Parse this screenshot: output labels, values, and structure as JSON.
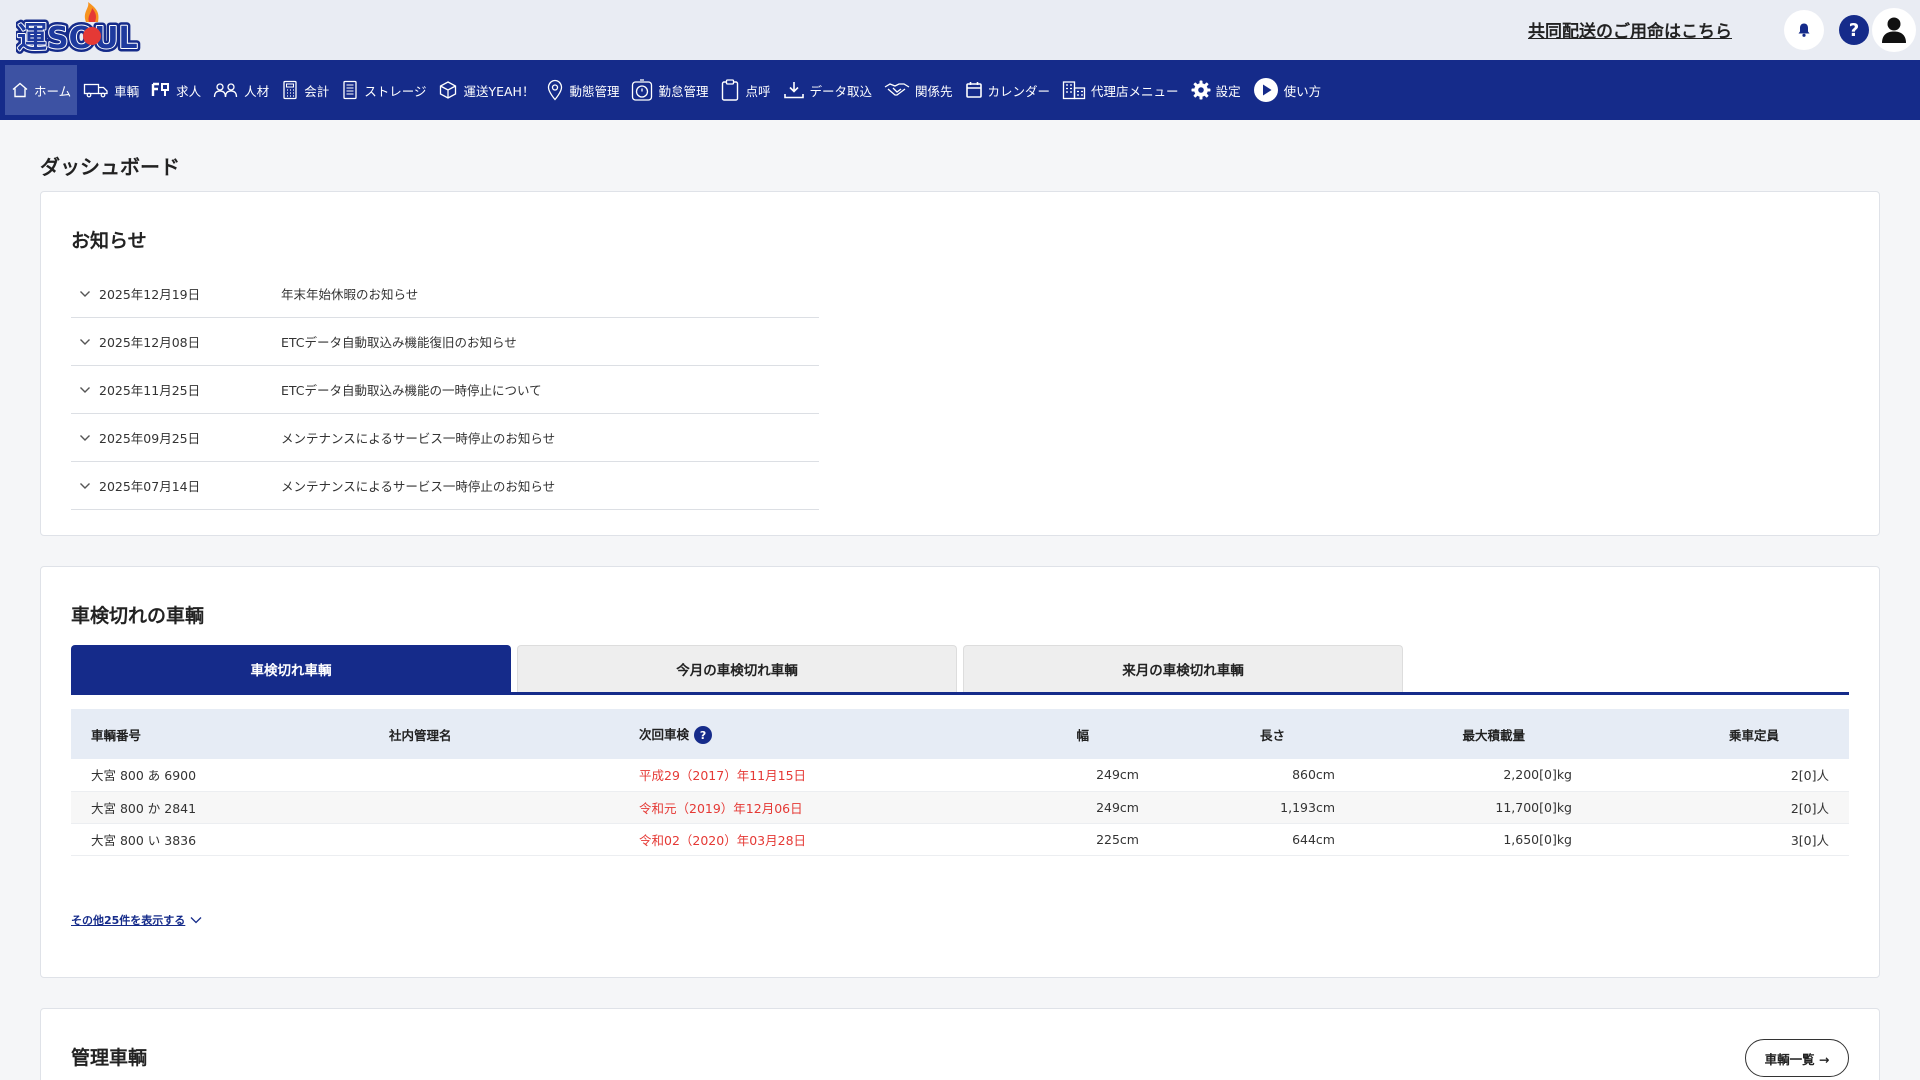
{
  "header": {
    "logo_text": "運SOUL",
    "joint_delivery_link": "共同配送のご用命はこちら"
  },
  "nav": {
    "items": [
      {
        "label": "ホーム",
        "icon": "home-icon"
      },
      {
        "label": "車輌",
        "icon": "truck-icon"
      },
      {
        "label": "求人",
        "icon": "job-icon"
      },
      {
        "label": "人材",
        "icon": "people-icon"
      },
      {
        "label": "会計",
        "icon": "calculator-icon"
      },
      {
        "label": "ストレージ",
        "icon": "document-icon"
      },
      {
        "label": "運送YEAH！",
        "icon": "box-icon"
      },
      {
        "label": "動態管理",
        "icon": "location-pin-icon"
      },
      {
        "label": "勤怠管理",
        "icon": "timer-icon"
      },
      {
        "label": "点呼",
        "icon": "clipboard-icon"
      },
      {
        "label": "データ取込",
        "icon": "download-icon"
      },
      {
        "label": "関係先",
        "icon": "handshake-icon"
      },
      {
        "label": "カレンダー",
        "icon": "calendar-icon"
      },
      {
        "label": "代理店メニュー",
        "icon": "building-icon"
      },
      {
        "label": "設定",
        "icon": "gear-icon"
      },
      {
        "label": "使い方",
        "icon": "play-icon"
      }
    ]
  },
  "page": {
    "title": "ダッシュボード"
  },
  "news": {
    "title": "お知らせ",
    "items": [
      {
        "date": "2025年12月19日",
        "title": "年末年始休暇のお知らせ"
      },
      {
        "date": "2025年12月08日",
        "title": "ETCデータ自動取込み機能復旧のお知らせ"
      },
      {
        "date": "2025年11月25日",
        "title": "ETCデータ自動取込み機能の一時停止について"
      },
      {
        "date": "2025年09月25日",
        "title": "メンテナンスによるサービス一時停止のお知らせ"
      },
      {
        "date": "2025年07月14日",
        "title": "メンテナンスによるサービス一時停止のお知らせ"
      }
    ]
  },
  "inspection": {
    "title": "車検切れの車輌",
    "tabs": [
      "車検切れ車輌",
      "今月の車検切れ車輌",
      "来月の車検切れ車輌"
    ],
    "columns": [
      "車輌番号",
      "社内管理名",
      "次回車検",
      "幅",
      "長さ",
      "最大積載量",
      "乗車定員"
    ],
    "help_mark": "?",
    "rows": [
      {
        "number": "大宮 800 あ 6900",
        "name": "",
        "next": "平成29（2017）年11月15日",
        "width": "249cm",
        "length": "860cm",
        "load": "2,200[0]kg",
        "capacity": "2[0]人"
      },
      {
        "number": "大宮 800 か 2841",
        "name": "",
        "next": "令和元（2019）年12月06日",
        "width": "249cm",
        "length": "1,193cm",
        "load": "11,700[0]kg",
        "capacity": "2[0]人"
      },
      {
        "number": "大宮 800 い 3836",
        "name": "",
        "next": "令和02（2020）年03月28日",
        "width": "225cm",
        "length": "644cm",
        "load": "1,650[0]kg",
        "capacity": "3[0]人"
      }
    ],
    "more_link": "その他25件を表示する"
  },
  "managed": {
    "title": "管理車輌",
    "list_button": "車輌一覧 →"
  },
  "colors": {
    "navy": "#152b8a",
    "expired_red": "#e53935"
  }
}
